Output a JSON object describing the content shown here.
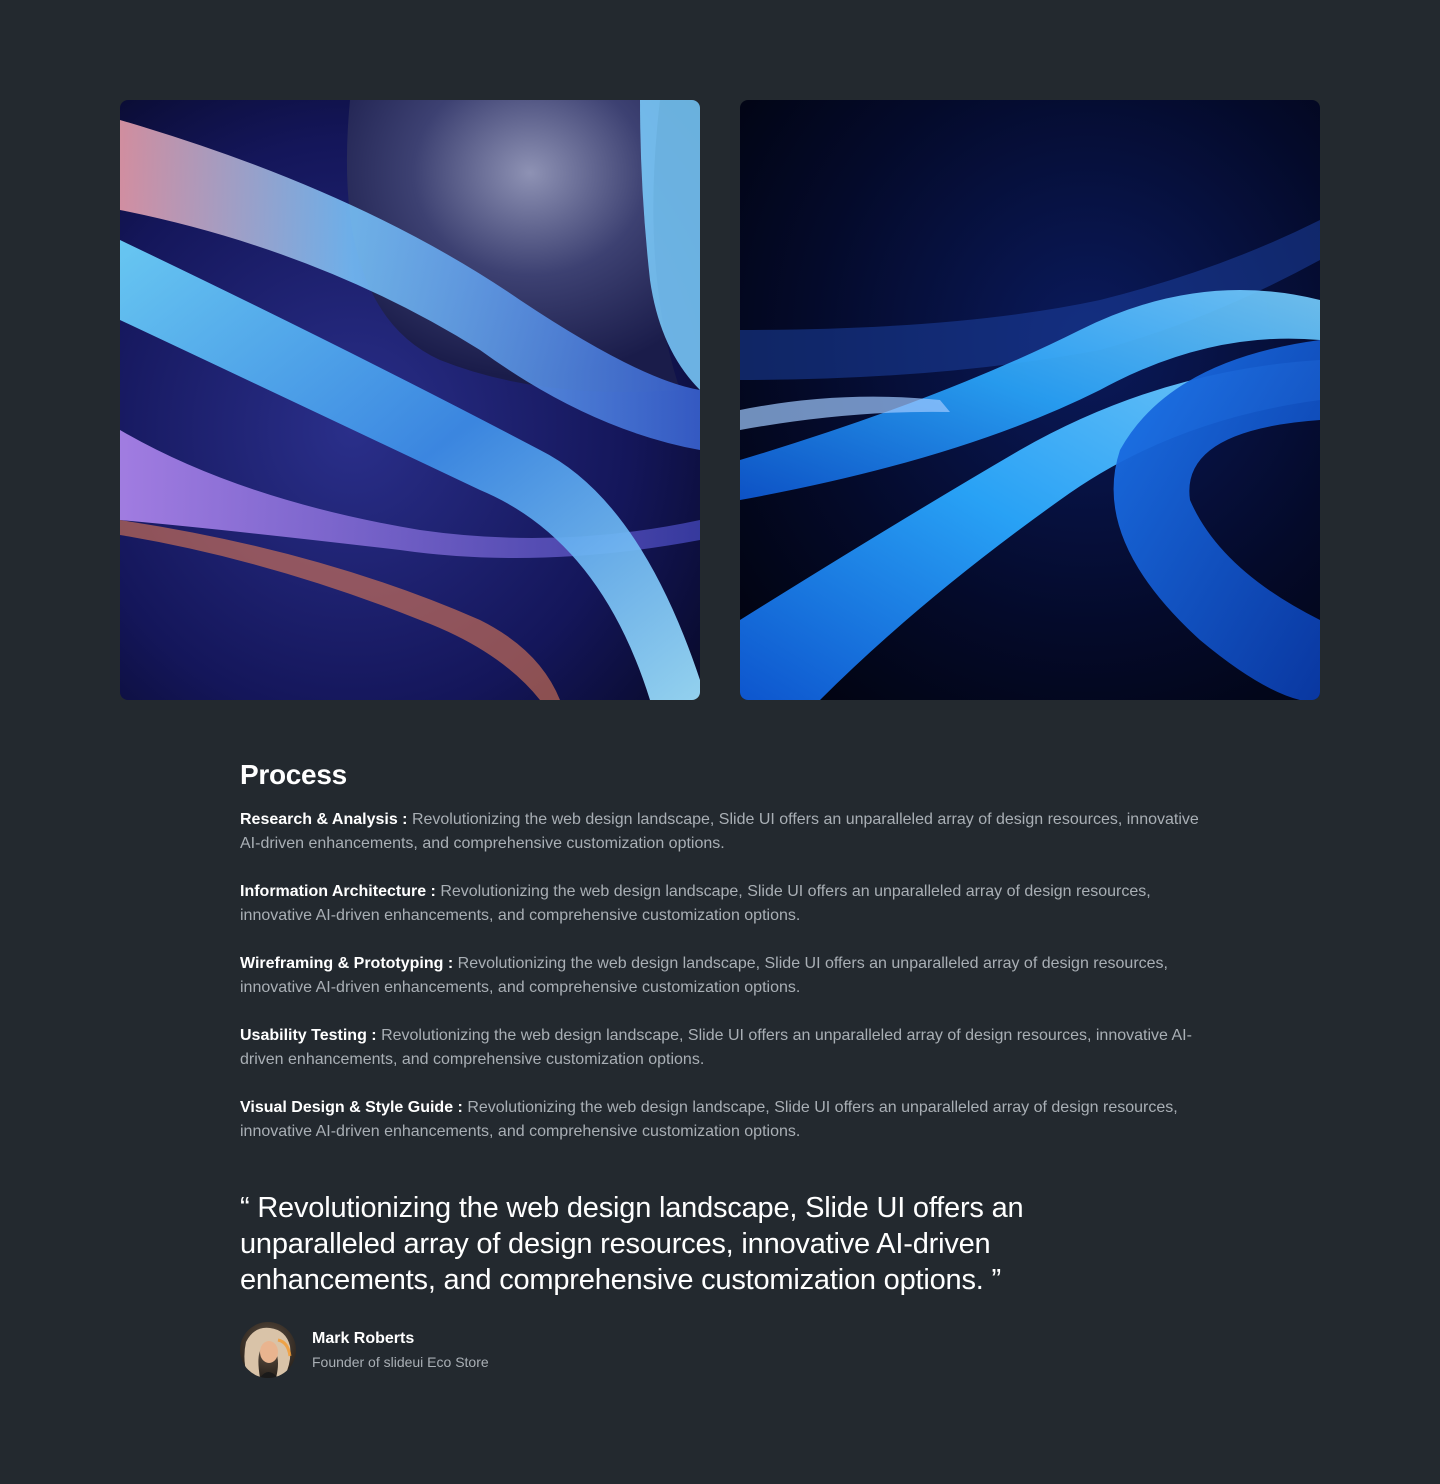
{
  "gallery": {
    "images": [
      {
        "icon": "abstract-wave-artwork-left-icon"
      },
      {
        "icon": "abstract-wave-artwork-right-icon"
      }
    ]
  },
  "process": {
    "title": "Process",
    "items": [
      {
        "term": "Research & Analysis :",
        "text": "Revolutionizing the web design landscape, Slide UI offers an unparalleled array of design resources, innovative AI-driven enhancements, and comprehensive customization options."
      },
      {
        "term": "Information Architecture :",
        "text": "Revolutionizing the web design landscape, Slide UI offers an unparalleled array of design resources, innovative AI-driven enhancements, and comprehensive customization options."
      },
      {
        "term": "Wireframing & Prototyping :",
        "text": "Revolutionizing the web design landscape, Slide UI offers an unparalleled array of design resources, innovative AI-driven enhancements, and comprehensive customization options."
      },
      {
        "term": "Usability Testing :",
        "text": "Revolutionizing the web design landscape, Slide UI offers an unparalleled array of design resources, innovative AI-driven enhancements, and comprehensive customization options."
      },
      {
        "term": "Visual Design & Style Guide :",
        "text": "Revolutionizing the web design landscape, Slide UI offers an unparalleled array of design resources, innovative AI-driven enhancements, and comprehensive customization options."
      }
    ]
  },
  "testimonial": {
    "quote": "“ Revolutionizing the web design landscape, Slide UI offers an unparalleled array of design resources, innovative AI-driven enhancements, and comprehensive customization options. ”",
    "author_name": "Mark Roberts",
    "author_role": "Founder of slideui Eco Store",
    "avatar_icon": "user-avatar-icon"
  },
  "colors": {
    "background": "#23292f",
    "text_primary": "#ffffff",
    "text_secondary": "#a9afb5"
  }
}
